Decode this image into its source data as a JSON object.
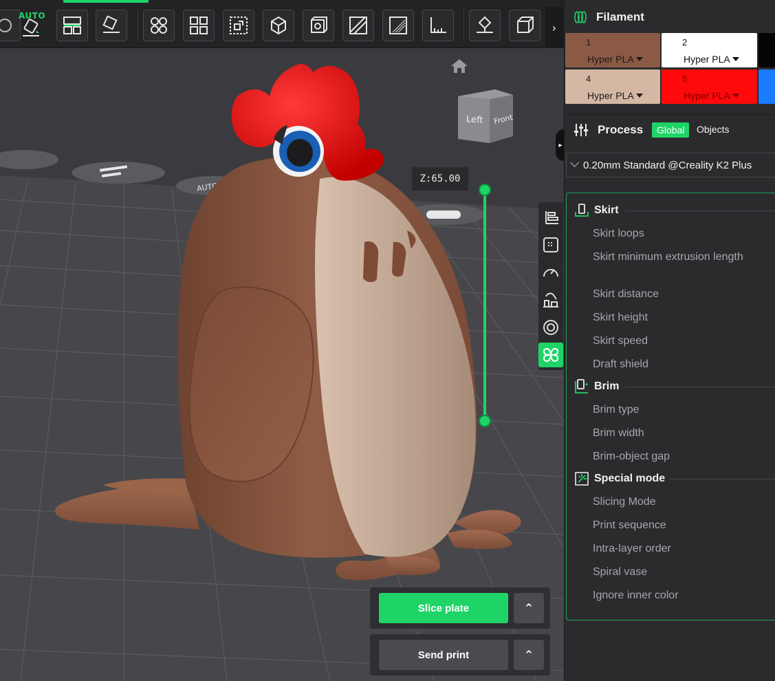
{
  "toolbar": {
    "auto_label": "AUTO",
    "tools": [
      "auto-orient-icon",
      "arrange-icon",
      "lay-on-face-icon",
      "split-objects-icon",
      "split-parts-icon",
      "scale-box-icon",
      "cut-icon",
      "hollow-box-icon",
      "emboss-icon",
      "support-paint-icon",
      "seam-paint-icon",
      "measure-icon",
      "color-paint-icon",
      "text-cube-icon"
    ],
    "expand_label": "›"
  },
  "viewport": {
    "cube_left": "Left",
    "cube_front": "Front",
    "z_label": "Z:65.00",
    "slice_plate": "Slice plate",
    "send_print": "Send print",
    "caret": "^"
  },
  "filament": {
    "title": "Filament",
    "slots": [
      {
        "num": "1",
        "name": "Hyper PLA",
        "color": "#8b5a44",
        "text": "#1a1a1a"
      },
      {
        "num": "2",
        "name": "Hyper PLA",
        "color": "#ffffff",
        "text": "#111111"
      },
      {
        "num": "",
        "name": "",
        "color": "#050505",
        "text": "#ffffff"
      },
      {
        "num": "4",
        "name": "Hyper PLA",
        "color": "#d4b8a4",
        "text": "#1a1a1a"
      },
      {
        "num": "5",
        "name": "Hyper PLA",
        "color": "#ff0a0a",
        "text": "#7a0000"
      },
      {
        "num": "",
        "name": "",
        "color": "#1a7bff",
        "text": "#ffffff"
      }
    ]
  },
  "process": {
    "title": "Process",
    "tab_global": "Global",
    "tab_objects": "Objects",
    "preset": "0.20mm Standard @Creality K2 Plus"
  },
  "settings": {
    "skirt": {
      "title": "Skirt",
      "options": [
        "Skirt loops",
        "Skirt minimum extrusion length",
        "Skirt distance",
        "Skirt height",
        "Skirt speed",
        "Draft shield"
      ]
    },
    "brim": {
      "title": "Brim",
      "options": [
        "Brim type",
        "Brim width",
        "Brim-object gap"
      ]
    },
    "special": {
      "title": "Special mode",
      "options": [
        "Slicing Mode",
        "Print sequence",
        "Intra-layer order",
        "Spiral vase",
        "Ignore inner color"
      ]
    }
  },
  "colors": {
    "accent": "#1fd467",
    "body_brown": "#8b5a44",
    "belly_tan": "#c9ad98",
    "comb_red": "#e00b0b",
    "eye_blue": "#1665c1"
  }
}
